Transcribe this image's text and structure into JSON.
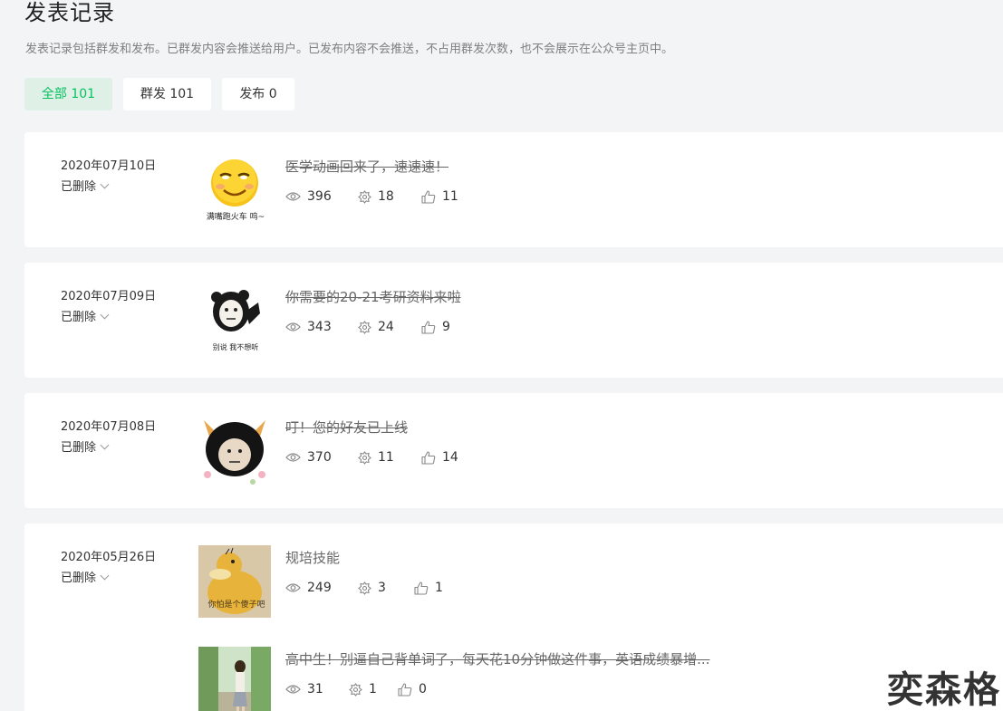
{
  "header": {
    "title": "发表记录",
    "description": "发表记录包括群发和发布。已群发内容会推送给用户。已发布内容不会推送，不占用群发次数，也不会展示在公众号主页中。"
  },
  "tabs": [
    {
      "label": "全部 101",
      "active": true
    },
    {
      "label": "群发 101",
      "active": false
    },
    {
      "label": "发布 0",
      "active": false
    }
  ],
  "records": [
    {
      "date": "2020年07月10日",
      "status": "已删除",
      "articles": [
        {
          "title": "医学动画回来了，速速速！",
          "deleted": true,
          "views": "396",
          "shares": "18",
          "likes": "11",
          "thumb_caption": "满嘴跑火车 呜~",
          "thumb": "emoji-face"
        }
      ]
    },
    {
      "date": "2020年07月09日",
      "status": "已删除",
      "articles": [
        {
          "title": "你需要的20-21考研资料来啦",
          "deleted": true,
          "views": "343",
          "shares": "24",
          "likes": "9",
          "thumb_caption": "别说 我不想听",
          "thumb": "panda-meme"
        }
      ]
    },
    {
      "date": "2020年07月08日",
      "status": "已删除",
      "articles": [
        {
          "title": "叮！您的好友已上线",
          "deleted": true,
          "views": "370",
          "shares": "11",
          "likes": "14",
          "thumb_caption": "",
          "thumb": "cat-ear-meme"
        }
      ]
    },
    {
      "date": "2020年05月26日",
      "status": "已删除",
      "articles": [
        {
          "title": "规培技能",
          "deleted": false,
          "views": "249",
          "shares": "3",
          "likes": "1",
          "thumb_caption": "你怕是个傻子吧",
          "thumb": "duck-image"
        },
        {
          "title": "高中生！别逼自己背单词了，每天花10分钟做这件事，英语成绩暴增...",
          "deleted": true,
          "views": "31",
          "shares": "1",
          "likes": "0",
          "thumb_caption": "",
          "thumb": "girl-photo"
        }
      ]
    }
  ],
  "watermark": "奕森格",
  "colors": {
    "accent": "#07c160",
    "active_tab_bg": "#dff1e6",
    "page_bg": "#f3f4f6"
  }
}
